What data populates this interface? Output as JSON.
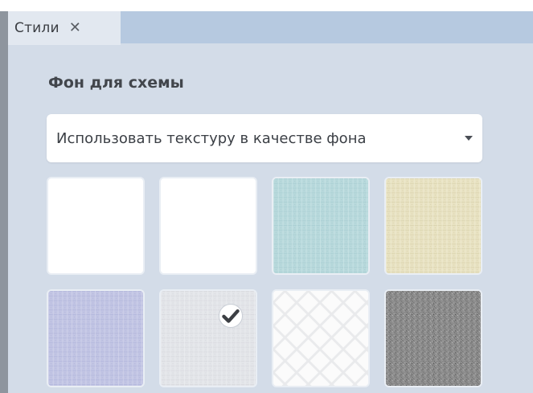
{
  "tab": {
    "label": "Стили",
    "close_glyph": "✕"
  },
  "section": {
    "title": "Фон для схемы"
  },
  "background_select": {
    "selected": "Использовать текстуру в качестве фона"
  },
  "textures": [
    {
      "id": "white-1",
      "color": "#ffffff",
      "selected": false
    },
    {
      "id": "white-2",
      "color": "#ffffff",
      "selected": false
    },
    {
      "id": "light-teal",
      "color": "#b7d8db",
      "selected": false
    },
    {
      "id": "cream",
      "color": "#e8e2c1",
      "selected": false
    },
    {
      "id": "lavender",
      "color": "#c1c4e3",
      "selected": false
    },
    {
      "id": "light-gray",
      "color": "#e2e4e8",
      "selected": true
    },
    {
      "id": "white-diamond",
      "color": "#fafafa",
      "selected": false
    },
    {
      "id": "dark-gray-noise",
      "color": "#8a8a8a",
      "selected": false
    }
  ],
  "colors": {
    "panel_bg": "#d3dce8",
    "tabbar_bg": "#b6c9e0",
    "tab_bg": "#e2e8f0"
  }
}
